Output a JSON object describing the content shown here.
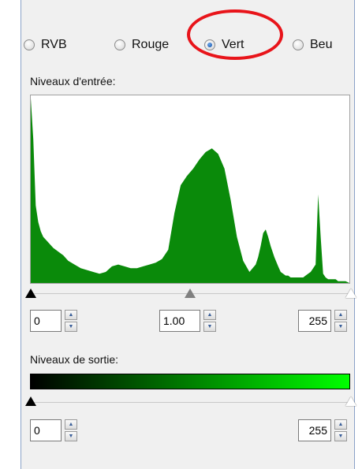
{
  "channels": {
    "options": [
      "RVB",
      "Rouge",
      "Vert",
      "Beu"
    ],
    "selected": "Vert"
  },
  "input_levels": {
    "label": "Niveaux d'entrée:",
    "black_value": "0",
    "gamma_value": "1.00",
    "white_value": "255"
  },
  "output_levels": {
    "label": "Niveaux de sortie:",
    "black_value": "0",
    "white_value": "255"
  },
  "colors": {
    "histogram_fill": "#0a8a0a",
    "highlight": "#e8141a",
    "gradient_start": "#000000",
    "gradient_end": "#00ff00"
  },
  "chart_data": {
    "type": "area",
    "x": [
      0,
      2,
      4,
      6,
      8,
      10,
      14,
      18,
      22,
      26,
      30,
      35,
      40,
      45,
      50,
      55,
      60,
      65,
      70,
      75,
      80,
      85,
      90,
      95,
      100,
      105,
      110,
      115,
      120,
      125,
      130,
      135,
      140,
      145,
      150,
      155,
      160,
      165,
      170,
      175,
      180,
      182,
      184,
      186,
      188,
      190,
      192,
      195,
      198,
      200,
      202,
      204,
      206,
      208,
      210,
      212,
      214,
      216,
      218,
      220,
      222,
      224,
      226,
      228,
      230,
      232,
      234,
      236,
      238,
      240,
      242,
      244,
      246,
      248,
      250,
      252,
      255
    ],
    "values": [
      1.0,
      0.78,
      0.42,
      0.33,
      0.28,
      0.25,
      0.22,
      0.19,
      0.17,
      0.15,
      0.12,
      0.1,
      0.08,
      0.07,
      0.06,
      0.05,
      0.06,
      0.09,
      0.1,
      0.09,
      0.08,
      0.08,
      0.09,
      0.1,
      0.11,
      0.13,
      0.18,
      0.38,
      0.53,
      0.58,
      0.62,
      0.67,
      0.71,
      0.73,
      0.7,
      0.62,
      0.45,
      0.25,
      0.12,
      0.06,
      0.1,
      0.14,
      0.2,
      0.27,
      0.29,
      0.25,
      0.2,
      0.14,
      0.09,
      0.06,
      0.05,
      0.04,
      0.04,
      0.03,
      0.03,
      0.03,
      0.03,
      0.03,
      0.03,
      0.04,
      0.05,
      0.06,
      0.08,
      0.1,
      0.48,
      0.25,
      0.05,
      0.03,
      0.02,
      0.02,
      0.02,
      0.02,
      0.01,
      0.01,
      0.01,
      0.01,
      0.0
    ],
    "xlim": [
      0,
      255
    ],
    "ylim": [
      0,
      1
    ]
  }
}
